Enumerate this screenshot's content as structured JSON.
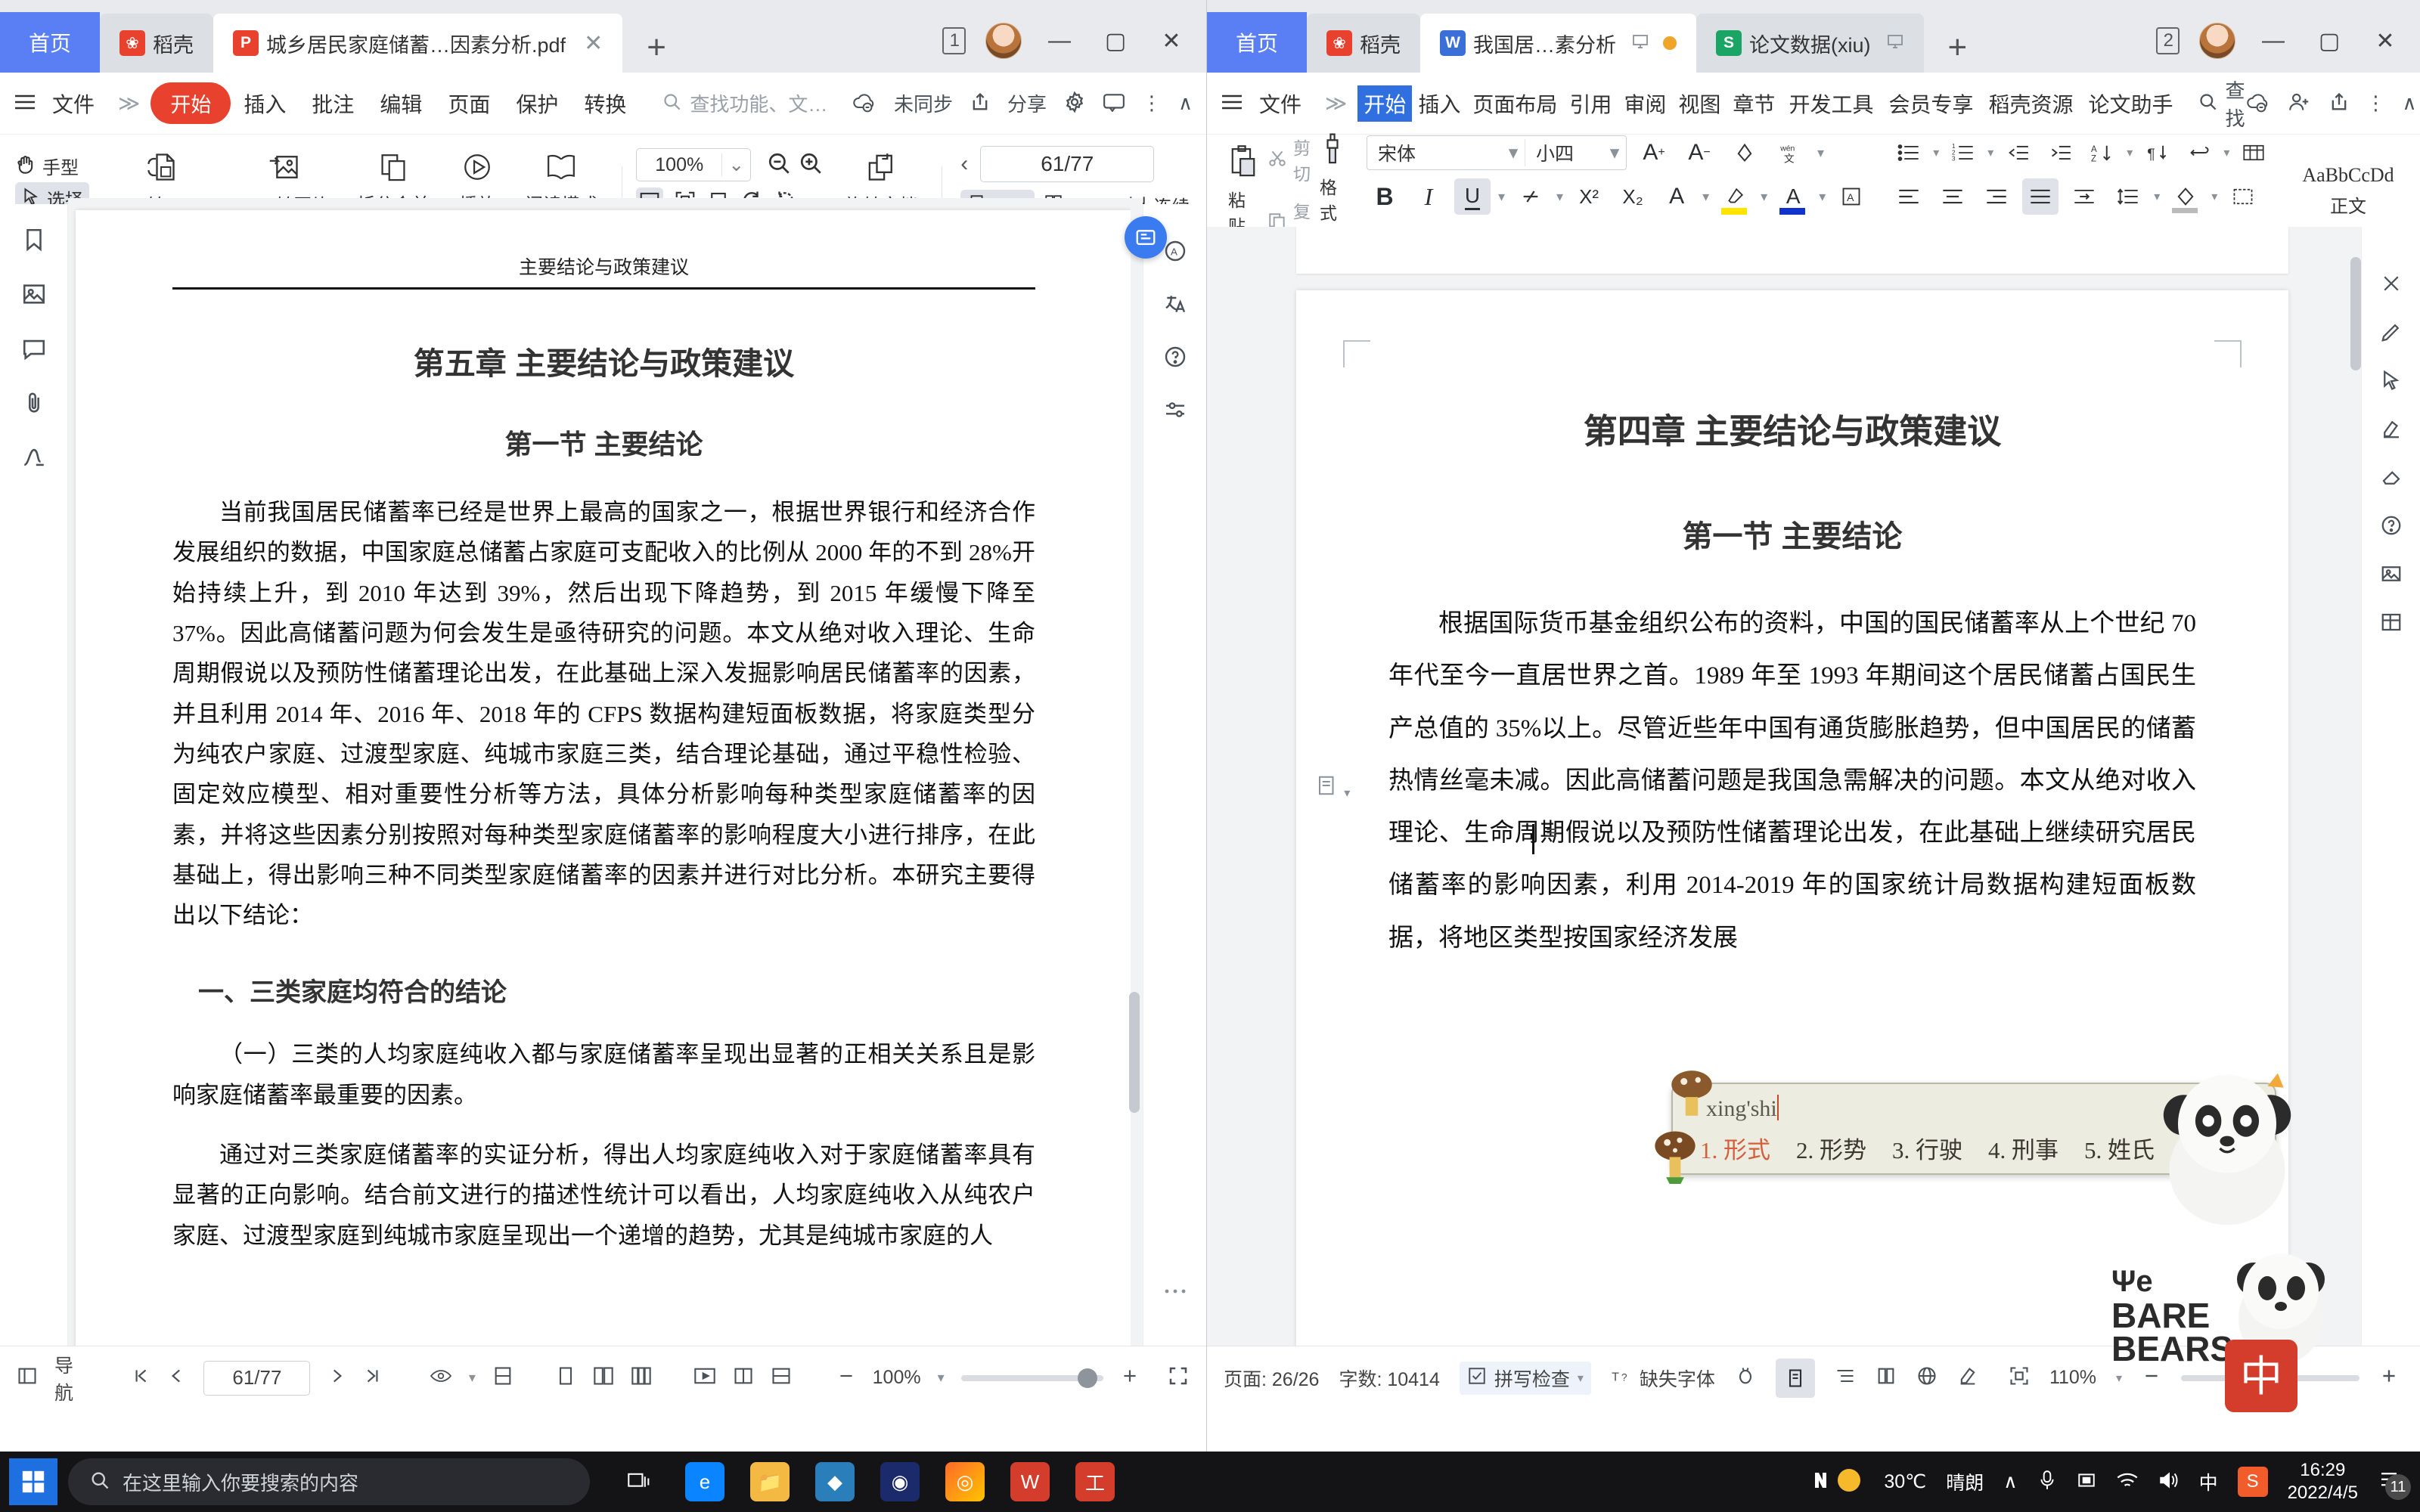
{
  "pdf_window": {
    "tabs": [
      {
        "label": "首页",
        "kind": "home"
      },
      {
        "label": "稻壳",
        "kind": "plain",
        "icon": "docer-icon"
      },
      {
        "label": "城乡居民家庭储蓄…因素分析.pdf",
        "kind": "active",
        "icon": "pdf-icon"
      }
    ],
    "new_tab": "+",
    "window_badge": "1",
    "window_controls": {
      "minimize": "—",
      "maximize": "▢",
      "close": "✕"
    },
    "menu": {
      "file": "文件",
      "expand": "≫",
      "items": [
        "开始",
        "插入",
        "批注",
        "编辑",
        "页面",
        "保护",
        "转换"
      ],
      "search_placeholder": "查找功能、文…",
      "sync": "未同步",
      "share": "分享",
      "more": "⋮",
      "collapse": "∧"
    },
    "toolbar": {
      "hand": "手型",
      "select": "选择",
      "pdf_to_office": "PDF转Office",
      "pdf_to_image": "PDF转图片",
      "split_merge": "拆分合并",
      "play": "播放",
      "read_mode": "阅读模式",
      "zoom_value": "100%",
      "rotate_doc": "旋转文档",
      "page_indicator": "61/77",
      "single_page": "单页",
      "double_page": "双页",
      "continuous": "连续"
    },
    "document": {
      "running_header": "主要结论与政策建议",
      "chapter_title": "第五章  主要结论与政策建议",
      "section_title": "第一节  主要结论",
      "paragraph1": "当前我国居民储蓄率已经是世界上最高的国家之一，根据世界银行和经济合作发展组织的数据，中国家庭总储蓄占家庭可支配收入的比例从 2000 年的不到 28%开始持续上升，到 2010 年达到 39%，然后出现下降趋势，到 2015 年缓慢下降至 37%。因此高储蓄问题为何会发生是亟待研究的问题。本文从绝对收入理论、生命周期假说以及预防性储蓄理论出发，在此基础上深入发掘影响居民储蓄率的因素，并且利用 2014 年、2016 年、2018 年的 CFPS 数据构建短面板数据，将家庭类型分为纯农户家庭、过渡型家庭、纯城市家庭三类，结合理论基础，通过平稳性检验、固定效应模型、相对重要性分析等方法，具体分析影响每种类型家庭储蓄率的因素，并将这些因素分别按照对每种类型家庭储蓄率的影响程度大小进行排序，在此基础上，得出影响三种不同类型家庭储蓄率的因素并进行对比分析。本研究主要得出以下结论：",
      "heading_one": "一、三类家庭均符合的结论",
      "paragraph2": "（一）三类的人均家庭纯收入都与家庭储蓄率呈现出显著的正相关关系且是影响家庭储蓄率最重要的因素。",
      "paragraph3": "通过对三类家庭储蓄率的实证分析，得出人均家庭纯收入对于家庭储蓄率具有显著的正向影响。结合前文进行的描述性统计可以看出，人均家庭纯收入从纯农户家庭、过渡型家庭到纯城市家庭呈现出一个递增的趋势，尤其是纯城市家庭的人"
    },
    "status": {
      "nav": "导航",
      "page_value": "61/77",
      "zoom_value": "100%"
    }
  },
  "word_window": {
    "tabs": [
      {
        "label": "首页",
        "kind": "home"
      },
      {
        "label": "稻壳",
        "kind": "plain",
        "icon": "docer-icon"
      },
      {
        "label": "我国居…素分析",
        "kind": "active",
        "icon": "word-icon"
      },
      {
        "label": "论文数据(xiu)",
        "kind": "inactive",
        "icon": "excel-icon"
      }
    ],
    "new_tab": "+",
    "window_badge": "2",
    "window_controls": {
      "minimize": "—",
      "maximize": "▢",
      "close": "✕"
    },
    "menu": {
      "file": "文件",
      "expand": "≫",
      "items": [
        "开始",
        "插入",
        "页面布局",
        "引用",
        "审阅",
        "视图",
        "章节",
        "开发工具",
        "会员专享",
        "稻壳资源",
        "论文助手"
      ],
      "search": "查找",
      "more": "⋮",
      "collapse": "∧"
    },
    "ribbon": {
      "paste": "粘贴",
      "cut": "剪切",
      "copy": "复制",
      "format_painter": "格式刷",
      "font_name": "宋体",
      "font_size": "小四",
      "bold": "B",
      "italic": "I",
      "underline": "U",
      "superscript": "X²",
      "subscript": "X₂",
      "style_preview": "AaBbCcDd",
      "style_name": "正文"
    },
    "document": {
      "chapter_title": "第四章  主要结论与政策建议",
      "section_title": "第一节  主要结论",
      "paragraph1": "根据国际货币基金组织公布的资料，中国的国民储蓄率从上个世纪 70 年代至今一直居世界之首。1989 年至 1993 年期间这个居民储蓄占国民生产总值的 35%以上。尽管近些年中国有通货膨胀趋势，但中国居民的储蓄热情丝毫未减。因此高储蓄问题是我国急需解决的问题。本文从绝对收入理论、生命周期假说以及预防性储蓄理论出发，在此基础上继续研究居民储蓄率的影响因素，利用 2014-2019 年的国家统计局数据构建短面板数据，将地区类型按国家经济发展"
    },
    "status": {
      "pages": "页面: 26/26",
      "words": "字数: 10414",
      "spellcheck": "拼写检查",
      "missing_font": "缺失字体",
      "zoom_value": "110%"
    }
  },
  "ime": {
    "pinyin": "xing'shi",
    "candidates": [
      "1. 形式",
      "2. 形势",
      "3. 行驶",
      "4. 刑事",
      "5. 姓氏"
    ],
    "prev_arrow": "◀",
    "next_arrow": "▶"
  },
  "taskbar": {
    "search_placeholder": "在这里输入你要搜索的内容",
    "weather_temp": "30℃",
    "weather_desc": "晴朗",
    "ime_lang": "中",
    "time": "16:29",
    "date": "2022/4/5",
    "notification_count": "11",
    "tray_up": "∧"
  },
  "colors": {
    "brand_red": "#e8422f",
    "home_blue": "#5a7ff5",
    "word_blue": "#3a6fd8",
    "excel_green": "#1aa564",
    "accent_select": "#2f6fe0"
  }
}
